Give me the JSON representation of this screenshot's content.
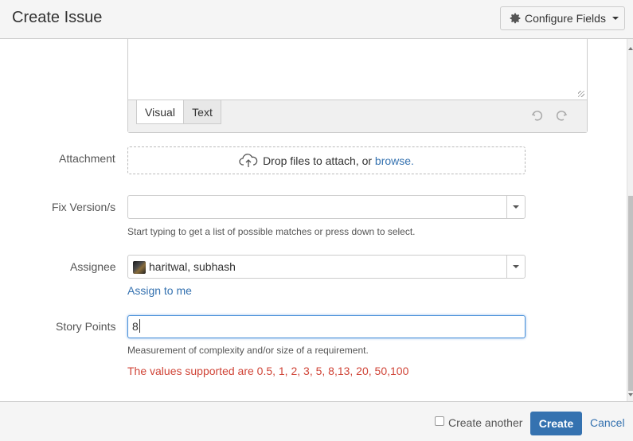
{
  "dialog": {
    "title": "Create Issue",
    "configure_fields_label": "Configure Fields"
  },
  "editor": {
    "tabs": [
      {
        "label": "Visual",
        "active": true
      },
      {
        "label": "Text",
        "active": false
      }
    ]
  },
  "attachment": {
    "label": "Attachment",
    "drop_text": "Drop files to attach, or",
    "browse_text": "browse."
  },
  "fix_version": {
    "label": "Fix Version/s",
    "value": "",
    "hint": "Start typing to get a list of possible matches or press down to select."
  },
  "assignee": {
    "label": "Assignee",
    "value": "haritwal, subhash",
    "assign_to_me": "Assign to me"
  },
  "story_points": {
    "label": "Story Points",
    "value": "8",
    "hint": "Measurement of complexity and/or size of a requirement.",
    "error": "The values supported are 0.5, 1, 2, 3, 5, 8,13, 20, 50,100"
  },
  "footer": {
    "create_another_label": "Create another",
    "create_another_checked": false,
    "create_label": "Create",
    "cancel_label": "Cancel"
  },
  "colors": {
    "link": "#3572b0",
    "primary_button": "#3572b0",
    "error": "#d04437",
    "focus_border": "#4a90d9"
  }
}
